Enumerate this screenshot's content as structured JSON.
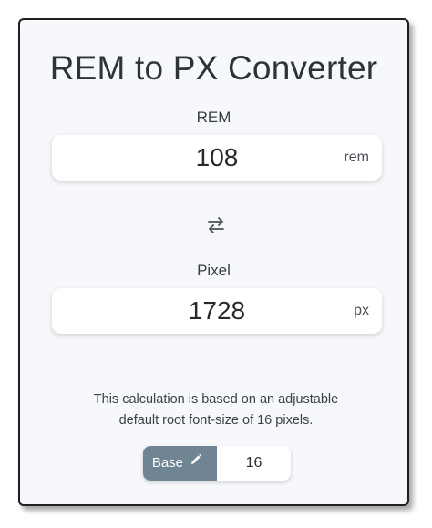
{
  "title": "REM to PX Converter",
  "rem_field": {
    "label": "REM",
    "value": "108",
    "unit": "rem"
  },
  "swap": {
    "icon": "swap-arrows-icon"
  },
  "px_field": {
    "label": "Pixel",
    "value": "1728",
    "unit": "px"
  },
  "note": {
    "line1": "This calculation is based on an adjustable",
    "line2": "default root font-size of 16 pixels."
  },
  "base": {
    "button_label": "Base",
    "icon": "pencil-icon",
    "value": "16"
  },
  "colors": {
    "card_background": "#f7f8fb",
    "base_button": "#6f8593",
    "text": "#2d3338"
  }
}
